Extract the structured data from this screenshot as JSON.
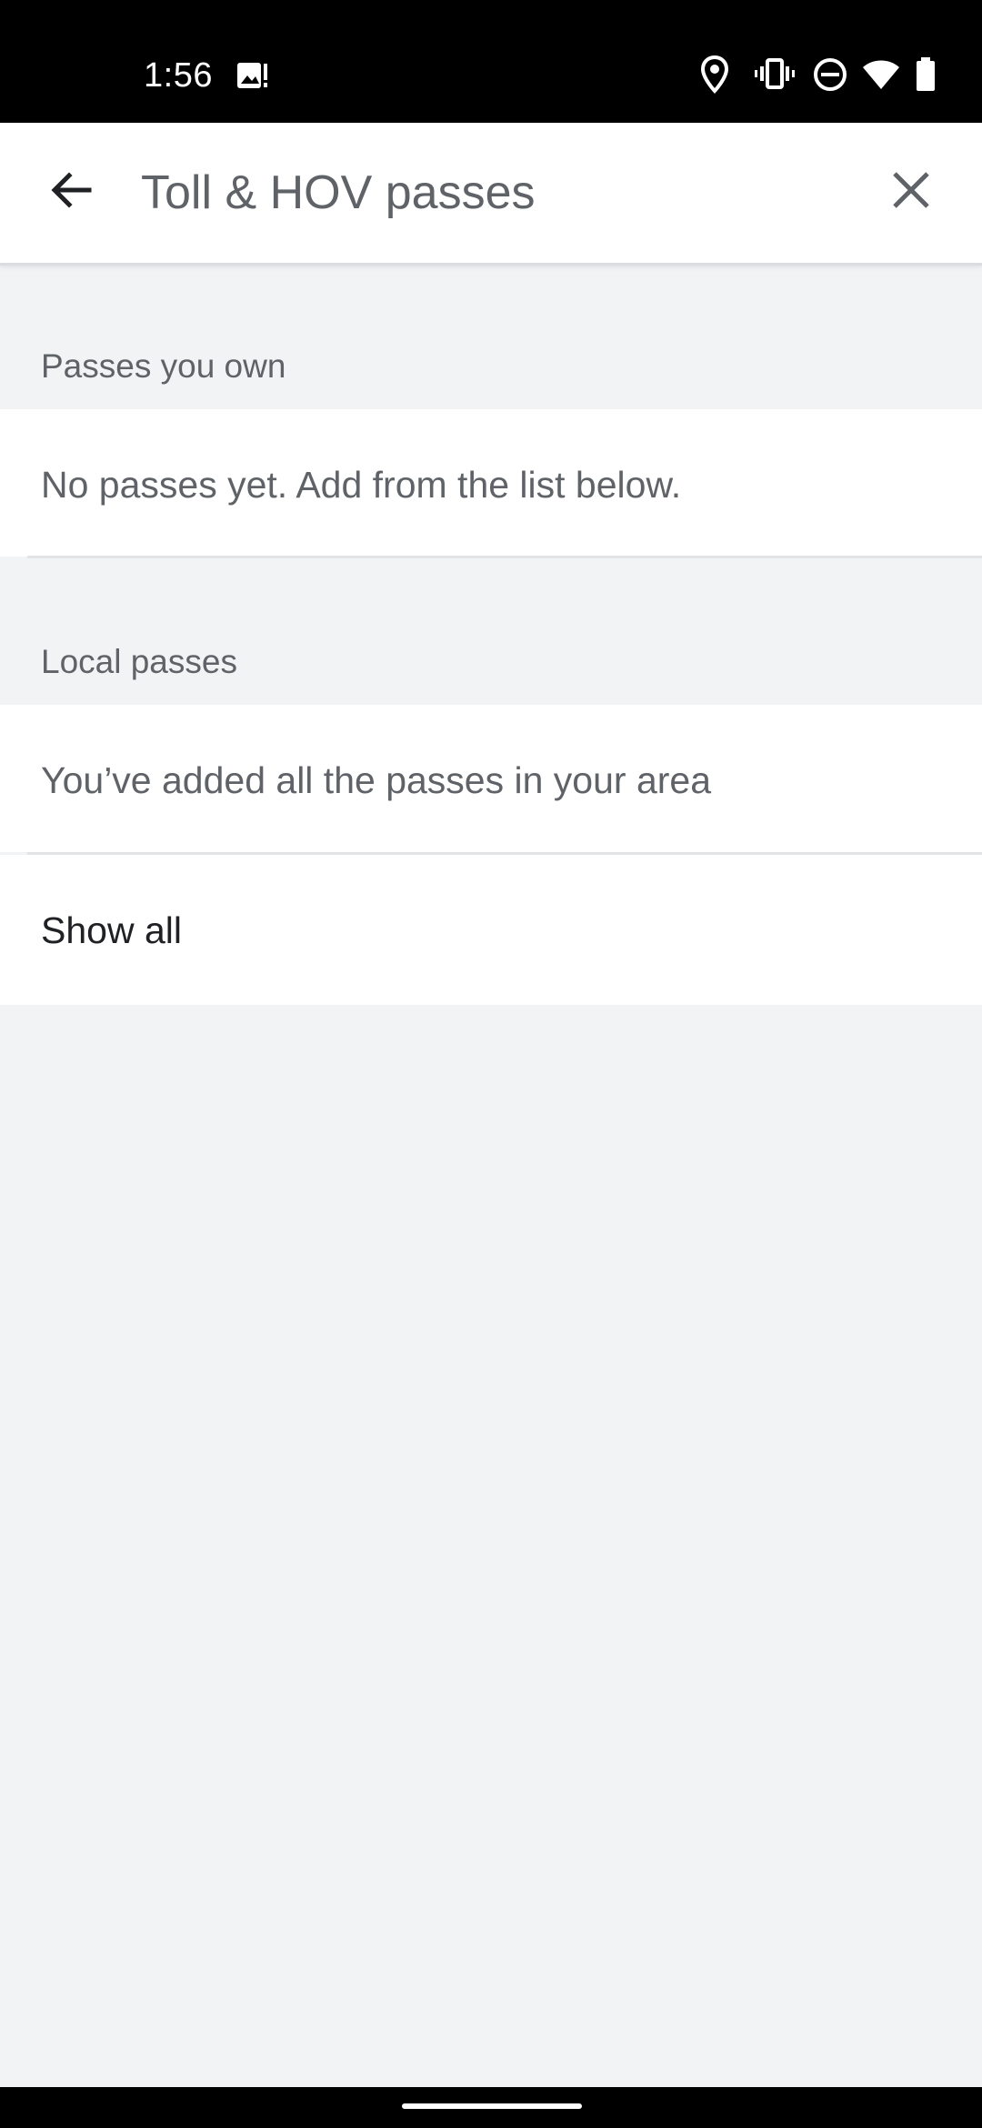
{
  "status_bar": {
    "time": "1:56",
    "icons": [
      "image-notification-icon",
      "location-icon",
      "vibrate-icon",
      "do-not-disturb-icon",
      "wifi-icon",
      "battery-icon"
    ]
  },
  "app_bar": {
    "title": "Toll & HOV passes",
    "back_icon": "arrow-back-icon",
    "close_icon": "close-icon"
  },
  "sections": {
    "owned": {
      "header": "Passes you own",
      "empty_message": "No passes yet. Add from the list below."
    },
    "local": {
      "header": "Local passes",
      "message": "You’ve added all the passes in your area",
      "show_all_label": "Show all"
    }
  },
  "colors": {
    "background": "#f1f3f4",
    "surface": "#ffffff",
    "primary_text": "#202124",
    "secondary_text": "#5f6368"
  }
}
